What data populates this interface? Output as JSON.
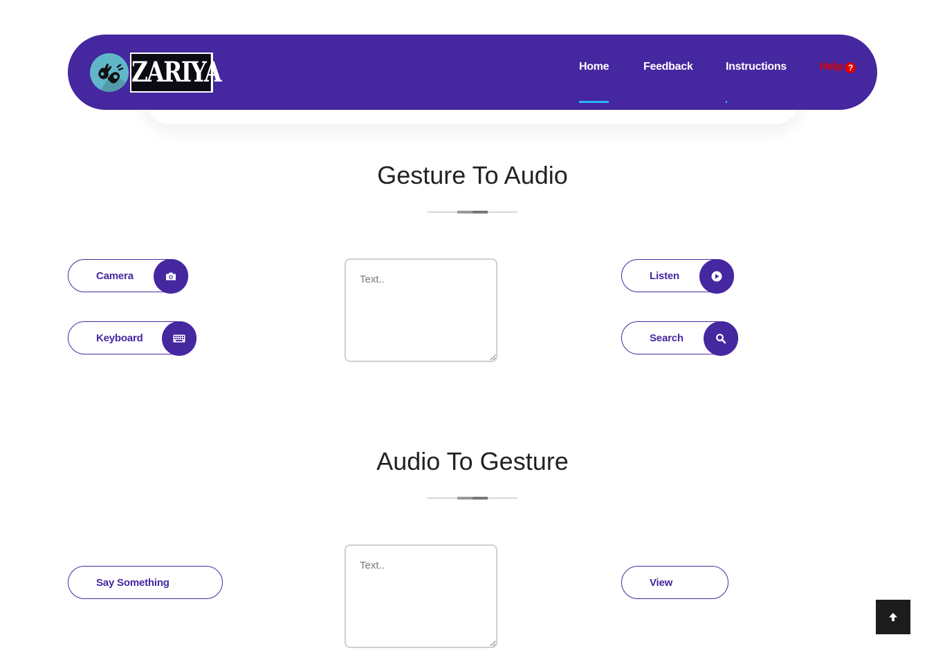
{
  "brand": {
    "logo_text": "ZARIYA",
    "logo_icon": "sign-language-hands-icon"
  },
  "nav": {
    "items": [
      {
        "label": "Home",
        "active": true
      },
      {
        "label": "Feedback",
        "active": false
      },
      {
        "label": "Instructions",
        "active": false
      },
      {
        "label": "Help",
        "active": false,
        "icon": "question-circle-icon"
      }
    ]
  },
  "gesture_to_audio": {
    "title": "Gesture To Audio",
    "camera_label": "Camera",
    "camera_icon": "camera-icon",
    "keyboard_label": "Keyboard",
    "keyboard_icon": "keyboard-icon",
    "text_placeholder": "Text..",
    "listen_label": "Listen",
    "listen_icon": "play-circle-icon",
    "search_label": "Search",
    "search_icon": "search-icon"
  },
  "audio_to_gesture": {
    "title": "Audio To Gesture",
    "say_label": "Say Something",
    "text_placeholder": "Text..",
    "view_label": "View"
  },
  "back_to_top_icon": "arrow-up-icon",
  "colors": {
    "primary": "#4527a0",
    "accent": "#29b6f6",
    "help": "#e00000",
    "back_to_top_bg": "#1c1c1c"
  }
}
